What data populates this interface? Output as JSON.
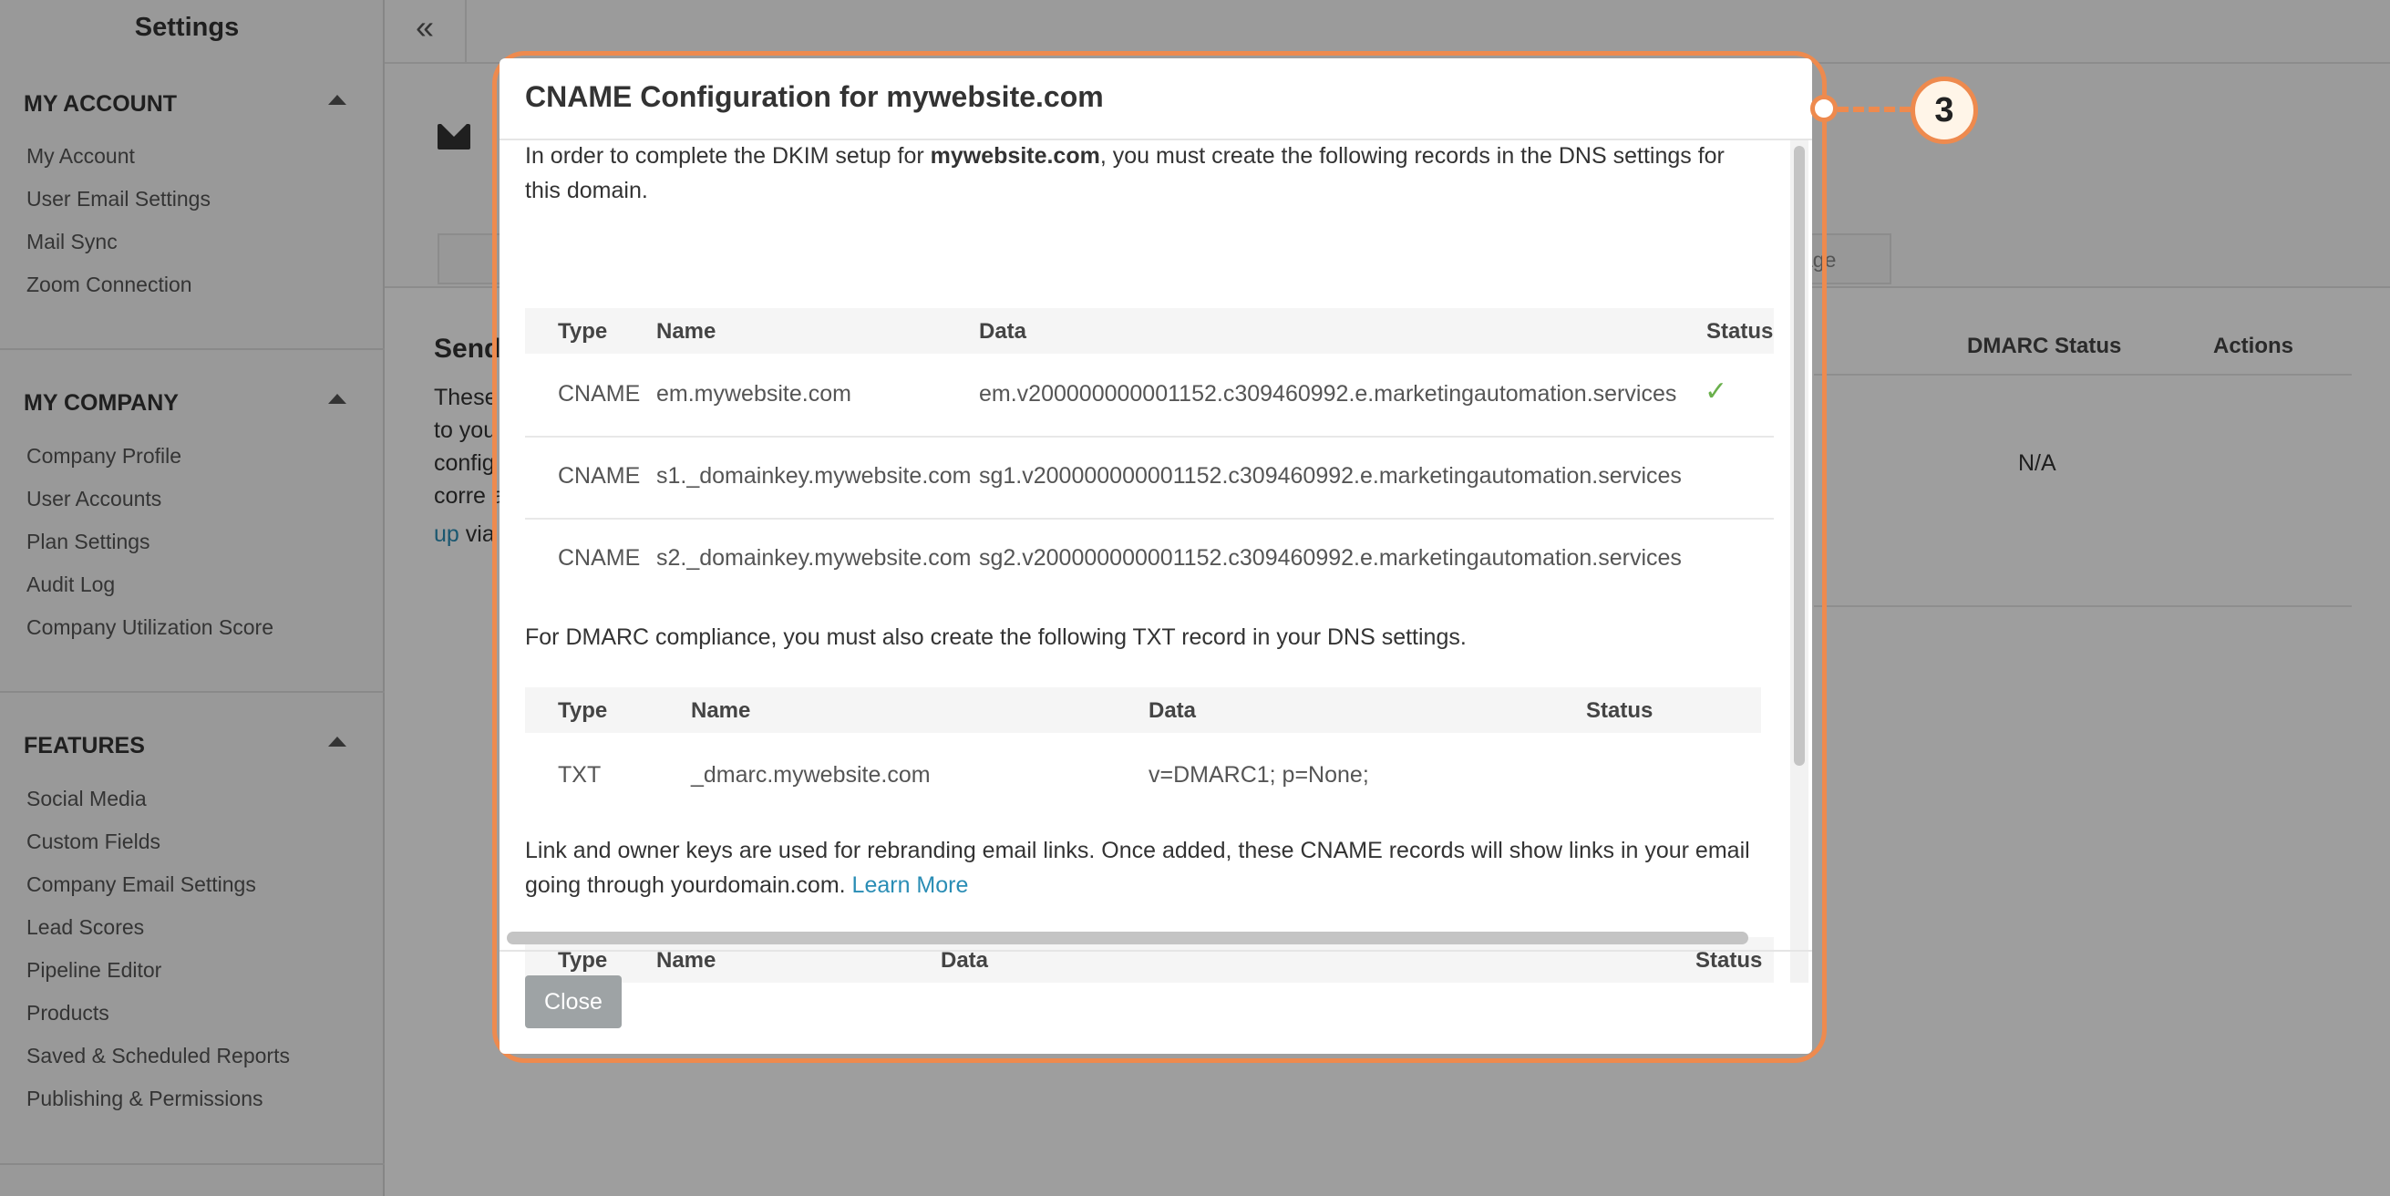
{
  "sidebar": {
    "title": "Settings",
    "sections": [
      {
        "header": "MY ACCOUNT",
        "items": [
          "My Account",
          "User Email Settings",
          "Mail Sync",
          "Zoom Connection"
        ]
      },
      {
        "header": "MY COMPANY",
        "items": [
          "Company Profile",
          "User Accounts",
          "Plan Settings",
          "Audit Log",
          "Company Utilization Score"
        ]
      },
      {
        "header": "FEATURES",
        "items": [
          "Social Media",
          "Custom Fields",
          "Company Email Settings",
          "Lead Scores",
          "Pipeline Editor",
          "Products",
          "Saved & Scheduled Reports",
          "Publishing & Permissions"
        ]
      }
    ]
  },
  "topbar": {
    "collapse_icon": "«"
  },
  "background": {
    "partial_tab": "age",
    "section_title": "Send",
    "partial_lines": [
      "These",
      "to you",
      "config",
      "corre a"
    ],
    "partial_link": "up",
    "partial_after_link": " via",
    "col_dmarc": "DMARC Status",
    "col_actions": "Actions",
    "dmarc_value": "N/A"
  },
  "modal": {
    "title": "CNAME Configuration for mywebsite.com",
    "intro_pre": "In order to complete the DKIM setup for ",
    "intro_domain": "mywebsite.com",
    "intro_post": ", you must create the following records in the DNS settings for this domain.",
    "cname_table": {
      "headers": [
        "Type",
        "Name",
        "Data",
        "Status"
      ],
      "rows": [
        {
          "type": "CNAME",
          "name": "em.mywebsite.com",
          "data": "em.v200000000001152.c309460992.e.marketingautomation.services",
          "status": "verified"
        },
        {
          "type": "CNAME",
          "name": "s1._domainkey.mywebsite.com",
          "data": "sg1.v200000000001152.c309460992.e.marketingautomation.services",
          "status": ""
        },
        {
          "type": "CNAME",
          "name": "s2._domainkey.mywebsite.com",
          "data": "sg2.v200000000001152.c309460992.e.marketingautomation.services",
          "status": ""
        }
      ]
    },
    "dmarc_text": "For DMARC compliance, you must also create the following TXT record in your DNS settings.",
    "txt_table": {
      "headers": [
        "Type",
        "Name",
        "Data",
        "Status"
      ],
      "rows": [
        {
          "type": "TXT",
          "name": "_dmarc.mywebsite.com",
          "data": "v=DMARC1; p=None;",
          "status": ""
        }
      ]
    },
    "link_text_pre": "Link and owner keys are used for rebranding email links. Once added, these CNAME records will show links in your email going through yourdomain.com. ",
    "learn_more": "Learn More",
    "link_table": {
      "headers": [
        "Type",
        "Name",
        "Data",
        "Status"
      ]
    },
    "close_label": "Close"
  },
  "callout": {
    "number": "3"
  },
  "colors": {
    "accent": "#ee8a4e",
    "link": "#2a8db5",
    "check": "#6ab04c"
  },
  "icons": {
    "check": "✓"
  }
}
